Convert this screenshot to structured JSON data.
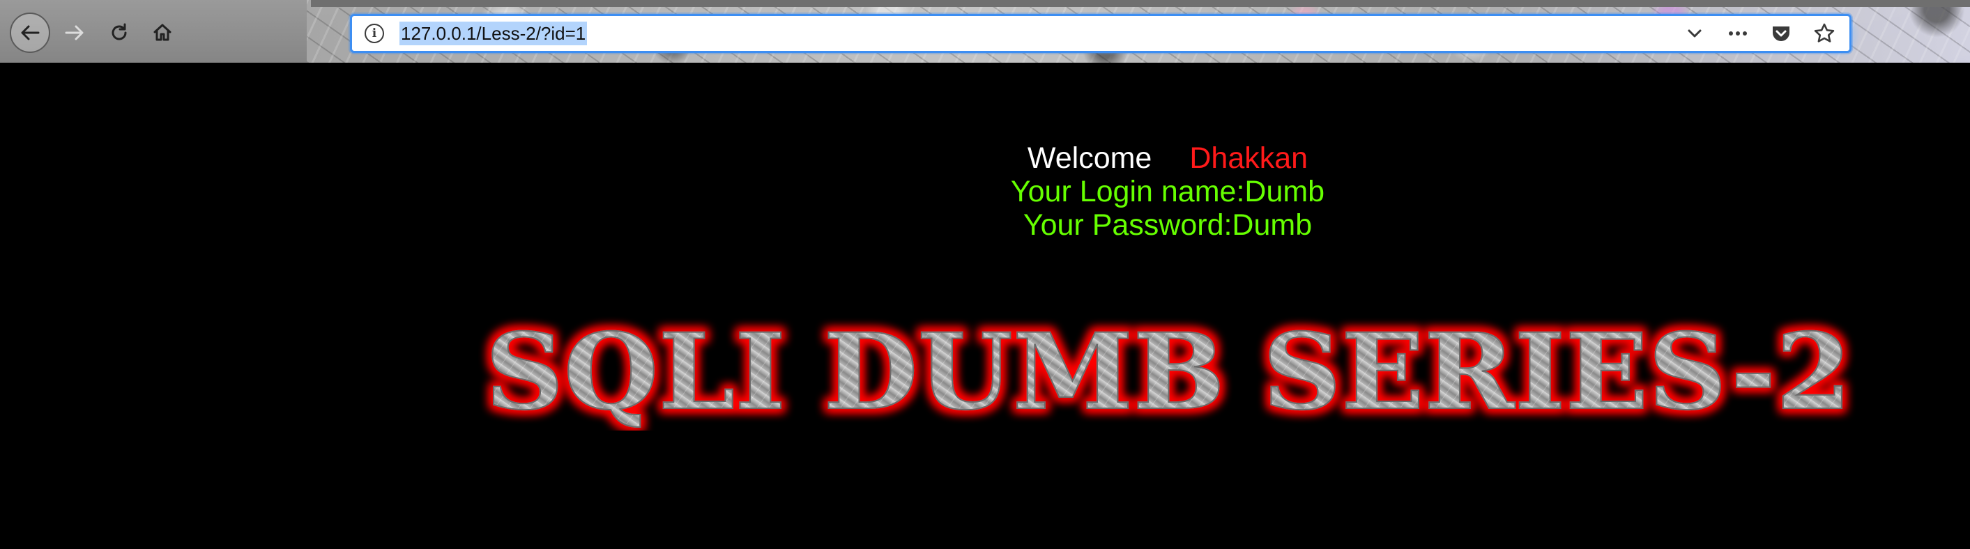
{
  "browser": {
    "url": "127.0.0.1/Less-2/?id=1",
    "icons": {
      "back": "arrow-left-icon",
      "forward": "arrow-right-icon",
      "reload": "reload-icon",
      "home": "home-icon",
      "site_info": "info-icon",
      "history_dropdown": "chevron-down-icon",
      "page_actions": "more-horizontal-icon",
      "pocket": "pocket-icon",
      "bookmark": "star-icon"
    },
    "info_glyph": "i"
  },
  "page": {
    "welcome_label": "Welcome",
    "welcome_name": "Dhakkan",
    "login_line": "Your Login name:Dumb",
    "password_line": "Your Password:Dumb",
    "banner_title": "SQLI DUMB SERIES-2",
    "colors": {
      "background": "#000000",
      "welcome": "#ffffff",
      "name": "#ff1a1a",
      "credentials": "#66ff00",
      "banner_glow": "#ff0000",
      "banner_fill": "#9a9a9a"
    }
  }
}
